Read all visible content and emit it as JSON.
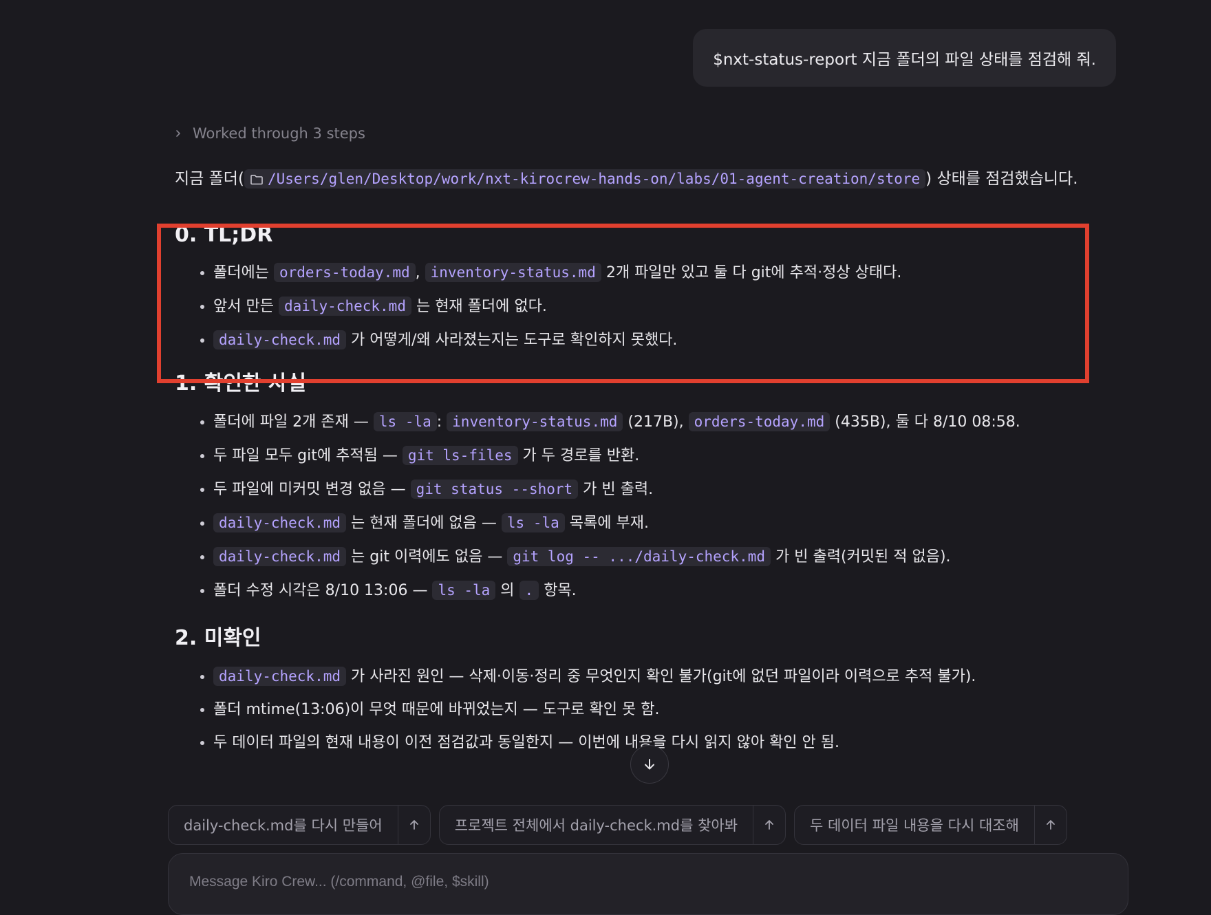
{
  "user_message": "$nxt-status-report 지금 폴더의 파일 상태를 점검해 줘.",
  "steps_toggle": "Worked through 3 steps",
  "intro": {
    "prefix": "지금 폴더(",
    "path": "/Users/glen/Desktop/work/nxt-kirocrew-hands-on/labs/01-agent-creation/store",
    "suffix": ") 상태를 점검했습니다."
  },
  "sections": [
    {
      "title": "0. TL;DR",
      "items": [
        [
          {
            "t": "폴더에는 "
          },
          {
            "c": "orders-today.md"
          },
          {
            "t": ", "
          },
          {
            "c": "inventory-status.md"
          },
          {
            "t": " 2개 파일만 있고 둘 다 git에 추적·정상 상태다."
          }
        ],
        [
          {
            "t": "앞서 만든 "
          },
          {
            "c": "daily-check.md"
          },
          {
            "t": " 는 현재 폴더에 없다."
          }
        ],
        [
          {
            "c": "daily-check.md"
          },
          {
            "t": " 가 어떻게/왜 사라졌는지는 도구로 확인하지 못했다."
          }
        ]
      ]
    },
    {
      "title": "1. 확인한 사실",
      "items": [
        [
          {
            "t": "폴더에 파일 2개 존재 — "
          },
          {
            "c": "ls -la"
          },
          {
            "t": ": "
          },
          {
            "c": "inventory-status.md"
          },
          {
            "t": " (217B), "
          },
          {
            "c": "orders-today.md"
          },
          {
            "t": " (435B), 둘 다 8/10 08:58."
          }
        ],
        [
          {
            "t": "두 파일 모두 git에 추적됨 — "
          },
          {
            "c": "git ls-files"
          },
          {
            "t": " 가 두 경로를 반환."
          }
        ],
        [
          {
            "t": "두 파일에 미커밋 변경 없음 — "
          },
          {
            "c": "git status --short"
          },
          {
            "t": " 가 빈 출력."
          }
        ],
        [
          {
            "c": "daily-check.md"
          },
          {
            "t": " 는 현재 폴더에 없음 — "
          },
          {
            "c": "ls -la"
          },
          {
            "t": " 목록에 부재."
          }
        ],
        [
          {
            "c": "daily-check.md"
          },
          {
            "t": " 는 git 이력에도 없음 — "
          },
          {
            "c": "git log -- .../daily-check.md"
          },
          {
            "t": " 가 빈 출력(커밋된 적 없음)."
          }
        ],
        [
          {
            "t": "폴더 수정 시각은 8/10 13:06 — "
          },
          {
            "c": "ls -la"
          },
          {
            "t": " 의 "
          },
          {
            "c": "."
          },
          {
            "t": " 항목."
          }
        ]
      ]
    },
    {
      "title": "2. 미확인",
      "items": [
        [
          {
            "c": "daily-check.md"
          },
          {
            "t": " 가 사라진 원인 — 삭제·이동·정리 중 무엇인지 확인 불가(git에 없던 파일이라 이력으로 추적 불가)."
          }
        ],
        [
          {
            "t": "폴더 mtime(13:06)이 무엇 때문에 바뀌었는지 — 도구로 확인 못 함."
          }
        ],
        [
          {
            "t": "두 데이터 파일의 현재 내용이 이전 점검값과 동일한지 — 이번에 내용을 다시 읽지 않아 확인 안 됨."
          }
        ]
      ]
    }
  ],
  "suggestions": [
    "daily-check.md를 다시 만들어",
    "프로젝트 전체에서 daily-check.md를 찾아봐",
    "두 데이터 파일 내용을 다시 대조해"
  ],
  "composer": {
    "placeholder": "Message Kiro Crew... (/command, @file, $skill)"
  },
  "colors": {
    "background": "#1b1a1f",
    "code_text": "#b5a3ff",
    "highlight_box": "#e1402f"
  },
  "icons": [
    "chevron-right-icon",
    "folder-icon",
    "arrow-down-icon",
    "arrow-up-icon"
  ]
}
